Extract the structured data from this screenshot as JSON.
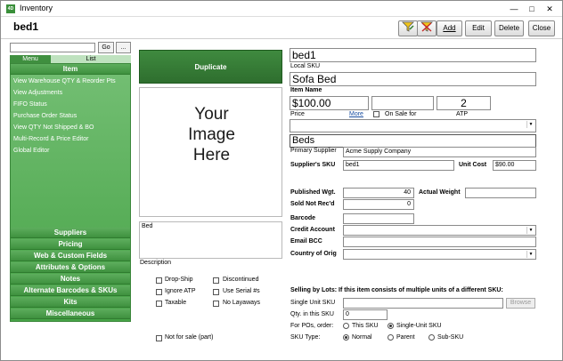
{
  "window": {
    "title": "Inventory",
    "icon": "app-icon"
  },
  "record": {
    "title": "bed1"
  },
  "toolbar": {
    "filter_icon": "filter-icon",
    "clear_filter_icon": "clear-filter-icon",
    "add": "Add",
    "edit": "Edit",
    "delete": "Delete",
    "close": "Close"
  },
  "sidebar": {
    "search": {
      "value": "",
      "go": "Go",
      "more": "..."
    },
    "tabs": [
      "Menu",
      "List"
    ],
    "header": "Item",
    "items": [
      "View Warehouse QTY & Reorder Pts",
      "View Adjustments",
      "FIFO Status",
      "Purchase Order Status",
      "View QTY Not Shipped & BO",
      "Multi-Record & Price Editor",
      "Global Editor"
    ],
    "sections": [
      "Suppliers",
      "Pricing",
      "Web & Custom Fields",
      "Attributes & Options",
      "Notes",
      "Alternate Barcodes & SKUs",
      "Kits",
      "Miscellaneous"
    ]
  },
  "main": {
    "duplicate": "Duplicate",
    "image_placeholder": [
      "Your",
      "Image",
      "Here"
    ],
    "description_value": "Bed",
    "description_label": "Description",
    "sku_value": "bed1",
    "local_sku_label": "Local SKU",
    "item_name_value": "Sofa Bed",
    "item_name_label": "Item Name",
    "price_value": "$100.00",
    "price_label": "Price",
    "more_link": "More",
    "on_sale_label": "On Sale for",
    "atp_value": "2",
    "atp_label": "ATP",
    "category_value": "",
    "category_popup": "Beds",
    "primary_supplier_label": "Primary Supplier",
    "primary_supplier_value": "Acme Supply Company",
    "supplier_sku_label": "Supplier's SKU",
    "supplier_sku_value": "bed1",
    "unit_cost_label": "Unit Cost",
    "unit_cost_value": "$90.00",
    "published_wgt_label": "Published Wgt.",
    "published_wgt_value": "40",
    "actual_weight_label": "Actual Weight",
    "actual_weight_value": "",
    "sold_not_recd_label": "Sold Not Rec'd",
    "sold_not_recd_value": "0",
    "barcode_label": "Barcode",
    "barcode_value": "",
    "credit_account_label": "Credit Account",
    "email_bcc_label": "Email BCC",
    "country_label": "Country of Orig",
    "checkboxes_left": [
      "Drop-Ship",
      "Ignore ATP",
      "Taxable"
    ],
    "checkboxes_right": [
      "Discontinued",
      "Use Serial #s",
      "No Layaways"
    ],
    "not_for_sale": "Not for sale (part)",
    "lots_heading": "Selling by Lots: If this item consists of multiple units of a different SKU:",
    "single_unit_sku_label": "Single Unit SKU",
    "single_unit_sku_value": "",
    "browse": "Browse",
    "qty_in_sku_label": "Qty. in this SKU",
    "qty_in_sku_value": "0",
    "for_pos_label": "For POs, order:",
    "po_options": [
      "This SKU",
      "Single-Unit SKU"
    ],
    "sku_type_label": "SKU Type:",
    "sku_types": [
      "Normal",
      "Parent",
      "Sub-SKU"
    ]
  },
  "colors": {
    "sidebar_green": "#47a347",
    "duplicate_green": "#2e6e2e",
    "link_blue": "#1a4ea0"
  }
}
